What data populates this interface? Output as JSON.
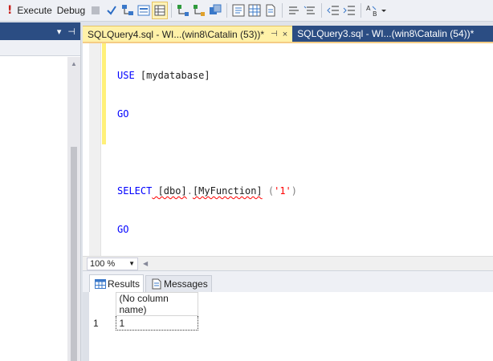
{
  "toolbar": {
    "execute_label": "Execute",
    "debug_label": "Debug"
  },
  "tabs": [
    {
      "label": "SQLQuery4.sql - WI...(win8\\Catalin (53))*",
      "active": true,
      "pin": "⊣",
      "close": "×"
    },
    {
      "label": "SQLQuery3.sql - WI...(win8\\Catalin (54))*",
      "active": false
    }
  ],
  "left_panel": {
    "pin_icon": "⊣",
    "dropdown_icon": "▾"
  },
  "editor": {
    "lines": [
      {
        "keyword": "USE",
        "rest": " [mydatabase]"
      },
      {
        "keyword": "GO"
      },
      {
        "blank": true
      },
      {
        "keyword": "SELECT",
        "part1": " [dbo]",
        "dot": ".",
        "part2": "[MyFunction]",
        "open": " (",
        "string": "'1'",
        "close": ")"
      },
      {
        "keyword": "GO"
      }
    ]
  },
  "zoom": {
    "value": "100 %"
  },
  "results_tabs": {
    "results_label": "Results",
    "messages_label": "Messages"
  },
  "grid": {
    "columns": [
      "(No column name)"
    ],
    "rows": [
      {
        "row_number": "1",
        "values": [
          "1"
        ]
      }
    ]
  },
  "colors": {
    "accent_dark_blue": "#2b4d83",
    "active_tab_yellow": "#fff1a8",
    "keyword_blue": "#0000ff",
    "string_red": "#ff0000"
  }
}
